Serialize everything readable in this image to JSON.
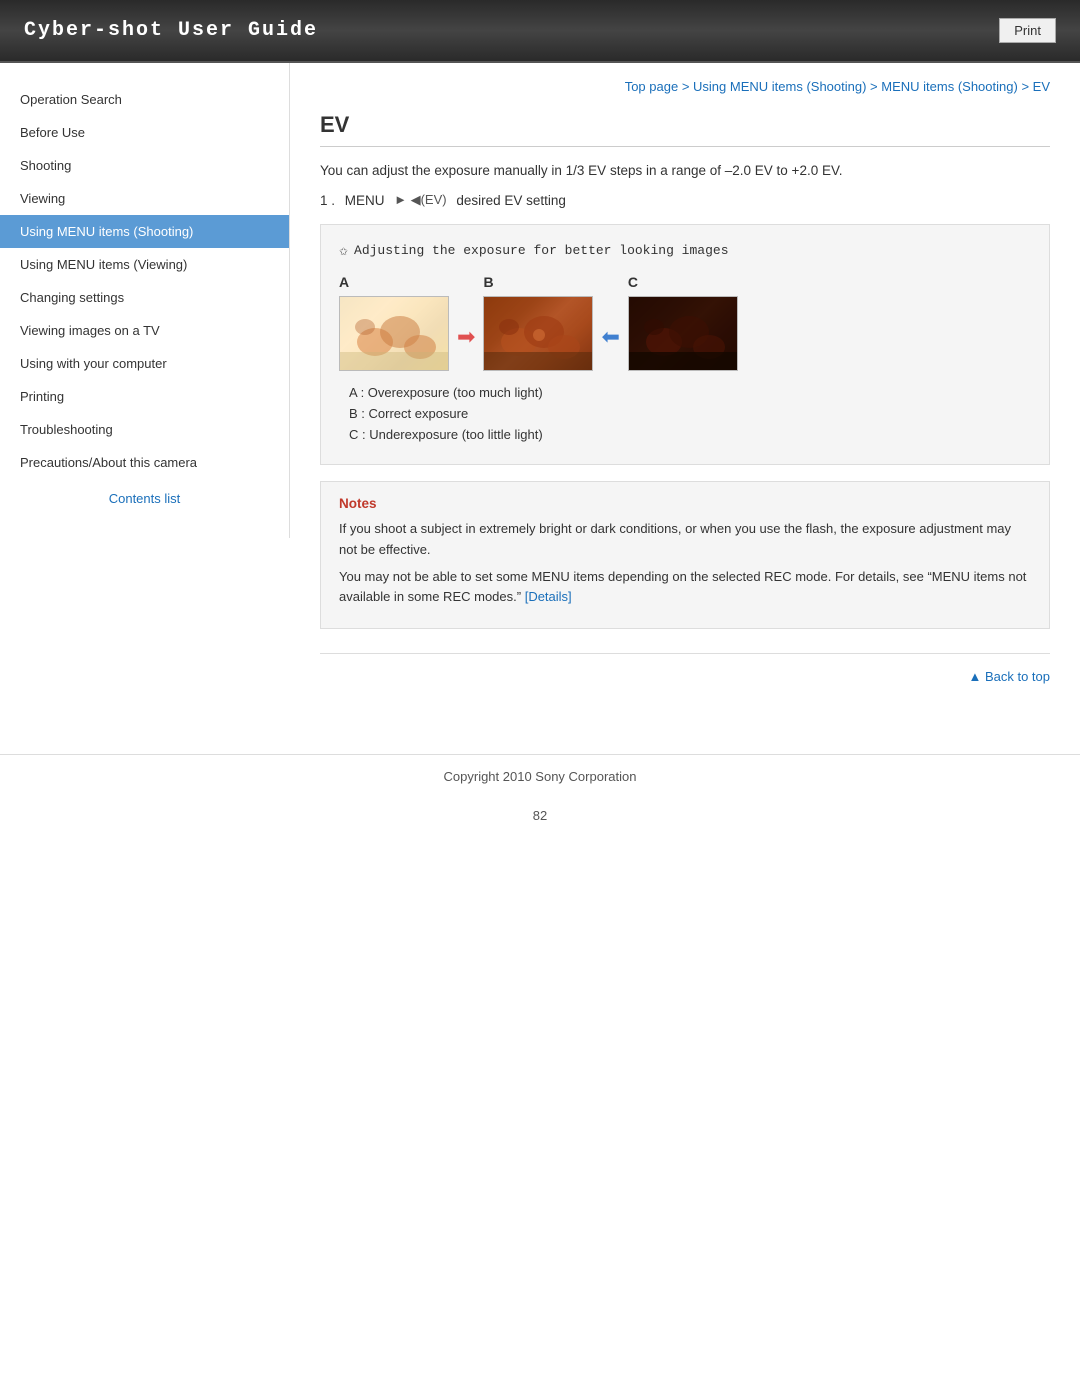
{
  "header": {
    "title": "Cyber-shot User Guide",
    "print_label": "Print"
  },
  "breadcrumb": {
    "items": [
      {
        "label": "Top page",
        "href": "#"
      },
      {
        "label": "Using MENU items (Shooting)",
        "href": "#"
      },
      {
        "label": "MENU items (Shooting)",
        "href": "#"
      },
      {
        "label": "EV",
        "href": "#"
      }
    ],
    "separator": " > "
  },
  "sidebar": {
    "items": [
      {
        "label": "Operation Search",
        "active": false
      },
      {
        "label": "Before Use",
        "active": false
      },
      {
        "label": "Shooting",
        "active": false
      },
      {
        "label": "Viewing",
        "active": false
      },
      {
        "label": "Using MENU items (Shooting)",
        "active": true
      },
      {
        "label": "Using MENU items (Viewing)",
        "active": false
      },
      {
        "label": "Changing settings",
        "active": false
      },
      {
        "label": "Viewing images on a TV",
        "active": false
      },
      {
        "label": "Using with your computer",
        "active": false
      },
      {
        "label": "Printing",
        "active": false
      },
      {
        "label": "Troubleshooting",
        "active": false
      },
      {
        "label": "Precautions/About this camera",
        "active": false
      }
    ],
    "contents_link_label": "Contents list"
  },
  "main": {
    "page_title": "EV",
    "description": "You can adjust the exposure manually in 1/3 EV steps in a range of –2.0 EV to +2.0 EV.",
    "step": {
      "number": "1 .",
      "text": "MENU",
      "symbol": "► ◄(EV)",
      "end": "desired EV setting"
    },
    "tip": {
      "icon": "★",
      "title": "Adjusting the exposure for better looking images",
      "diagram": {
        "cols": [
          {
            "label": "A",
            "type": "overexposed"
          },
          {
            "label": "B",
            "type": "correct"
          },
          {
            "label": "C",
            "type": "underexposed"
          }
        ],
        "arrows": [
          {
            "direction": "right",
            "color": "red"
          },
          {
            "direction": "left",
            "color": "blue"
          }
        ]
      },
      "captions": [
        "A : Overexposure (too much light)",
        "B : Correct exposure",
        "C : Underexposure (too little light)"
      ]
    },
    "notes": {
      "title": "Notes",
      "paragraphs": [
        "If you shoot a subject in extremely bright or dark conditions, or when you use the flash, the exposure adjustment may not be effective.",
        "You may not be able to set some MENU items depending on the selected REC mode. For details, see “MENU items not available in some REC modes.” [Details]"
      ],
      "details_link_label": "[Details]",
      "details_href": "#"
    },
    "back_to_top": "▲ Back to top"
  },
  "footer": {
    "copyright": "Copyright 2010 Sony Corporation",
    "page_number": "82"
  }
}
